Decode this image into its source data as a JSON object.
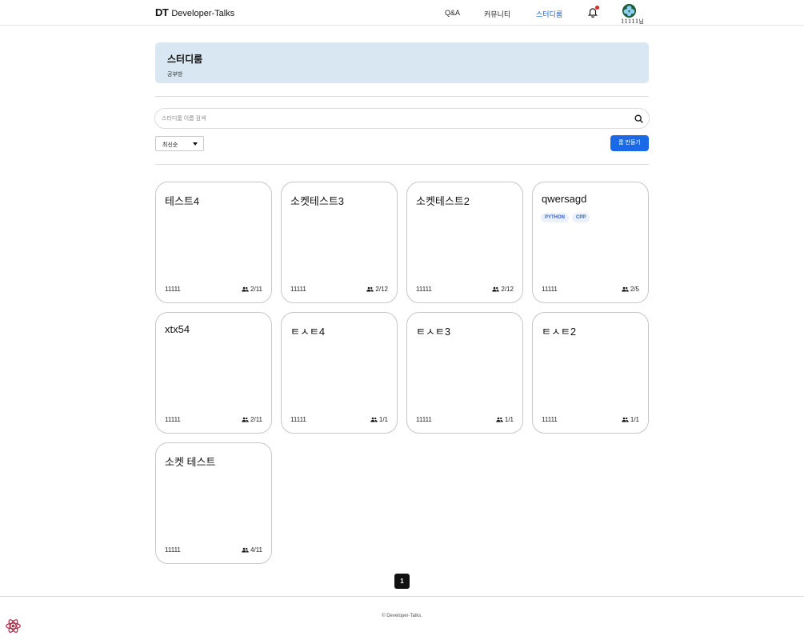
{
  "header": {
    "logo_mark": "DT",
    "logo_text": "Developer-Talks",
    "nav": [
      {
        "label": "Q&A"
      },
      {
        "label": "커뮤니티"
      },
      {
        "label": "스터디룸"
      }
    ],
    "user_name": "11111님"
  },
  "banner": {
    "title": "스터디룸",
    "subtitle": "공부방"
  },
  "search": {
    "placeholder": "스터디룸 이름 검색",
    "value": ""
  },
  "sort": {
    "selected": "최신순"
  },
  "create_button": "룸 만들기",
  "rooms": [
    {
      "title": "테스트4",
      "tags": [],
      "owner": "11111",
      "count": "2/11"
    },
    {
      "title": "소켓테스트3",
      "tags": [],
      "owner": "11111",
      "count": "2/12"
    },
    {
      "title": "소켓테스트2",
      "tags": [],
      "owner": "11111",
      "count": "2/12"
    },
    {
      "title": "qwersagd",
      "tags": [
        "PYTHON",
        "CPP"
      ],
      "owner": "11111",
      "count": "2/5"
    },
    {
      "title": "xtx54",
      "tags": [],
      "owner": "11111",
      "count": "2/11"
    },
    {
      "title": "ㅌㅅㅌ4",
      "tags": [],
      "owner": "11111",
      "count": "1/1"
    },
    {
      "title": "ㅌㅅㅌ3",
      "tags": [],
      "owner": "11111",
      "count": "1/1"
    },
    {
      "title": "ㅌㅅㅌ2",
      "tags": [],
      "owner": "11111",
      "count": "1/1"
    },
    {
      "title": "소켓 테스트",
      "tags": [],
      "owner": "11111",
      "count": "4/11"
    }
  ],
  "pagination": {
    "current": "1"
  },
  "footer": {
    "copyright": "© Developer-Talks."
  },
  "colors": {
    "accent": "#1a6ae8",
    "banner_bg": "#d8e7f1",
    "active_nav": "#1a62d6",
    "notification_dot": "#e0262b"
  },
  "icons": [
    "bell-icon",
    "avatar",
    "search-icon",
    "people-icon",
    "caret-down-icon",
    "react-icon"
  ]
}
